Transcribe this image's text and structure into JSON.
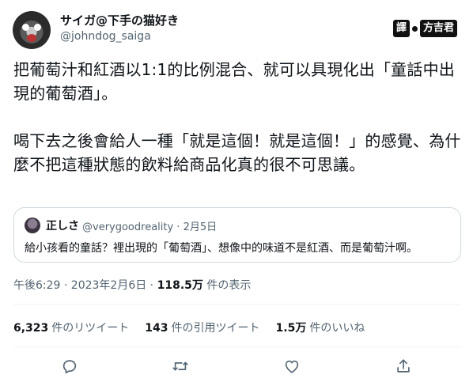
{
  "tweet": {
    "display_name": "サイガ@下手の猫好き",
    "handle": "@johndog_saiga",
    "text": "把葡萄汁和紅酒以1:1的比例混合、就可以具現化出「童話中出現的葡萄酒」。\n\n喝下去之後會給人一種「就是這個！就是這個！」的感覺、為什麼不把這種狀態的飲料給商品化真的很不可思議。",
    "time": "午後6:29 · 2023年2月6日 · ",
    "views_count": "118.5万",
    "views_label": " 件の表示"
  },
  "translator": {
    "label_1": "譯",
    "label_2": "方吉君"
  },
  "quote": {
    "name": "正しさ",
    "handle_date": "@verygoodreality · 2月5日",
    "text": "給小孩看的童話？裡出現的「葡萄酒」、想像中的味道不是紅酒、而是葡萄汁啊。"
  },
  "stats": {
    "retweets_count": "6,323",
    "retweets_label": "件のリツイート",
    "quotes_count": "143",
    "quotes_label": "件の引用ツイート",
    "likes_count": "1.5万",
    "likes_label": "件のいいね"
  },
  "icons": [
    "reply-icon",
    "retweet-icon",
    "like-icon",
    "share-icon"
  ]
}
